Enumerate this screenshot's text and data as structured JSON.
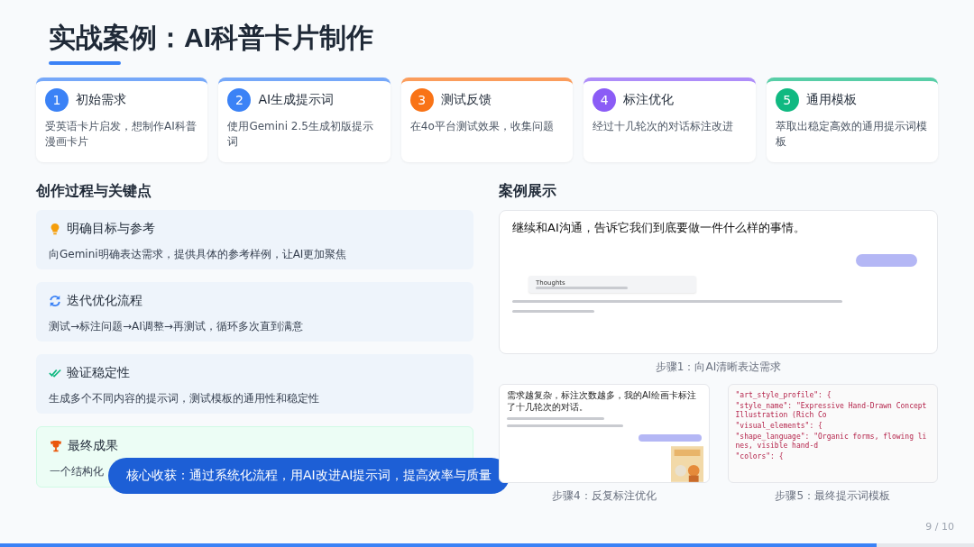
{
  "title": "实战案例：AI科普卡片制作",
  "steps": [
    {
      "number": "1",
      "title": "初始需求",
      "desc": "受英语卡片启发，想制作AI科普漫画卡片",
      "color": "#3b82f6"
    },
    {
      "number": "2",
      "title": "AI生成提示词",
      "desc": "使用Gemini 2.5生成初版提示词",
      "color": "#3b82f6"
    },
    {
      "number": "3",
      "title": "测试反馈",
      "desc": "在4o平台测试效果，收集问题",
      "color": "#f97316"
    },
    {
      "number": "4",
      "title": "标注优化",
      "desc": "经过十几轮次的对话标注改进",
      "color": "#8b5cf6"
    },
    {
      "number": "5",
      "title": "通用模板",
      "desc": "萃取出稳定高效的通用提示词模板",
      "color": "#10b981"
    }
  ],
  "process": {
    "heading": "创作过程与关键点",
    "items": [
      {
        "kind": "bulb",
        "title": "明确目标与参考",
        "desc": "向Gemini明确表达需求，提供具体的参考样例，让AI更加聚焦",
        "highlighted": false
      },
      {
        "kind": "sync",
        "title": "迭代优化流程",
        "desc": "测试→标注问题→AI调整→再测试，循环多次直到满意",
        "highlighted": false
      },
      {
        "kind": "check",
        "title": "验证稳定性",
        "desc": "生成多个不同内容的提示词，测试模板的通用性和稳定性",
        "highlighted": false
      },
      {
        "kind": "trophy",
        "title": "最终成果",
        "desc": "一个结构化",
        "highlighted": true
      }
    ]
  },
  "callout": "核心收获：通过系统化流程，用AI改进AI提示词，提高效率与质量",
  "cases": {
    "heading": "案例展示",
    "shot1": {
      "headline": "继续和AI沟通，告诉它我们到底要做一件什么样的事情。",
      "thoughts_title": "Thoughts",
      "caption": "步骤1：向AI清晰表达需求"
    },
    "shot4": {
      "headline": "需求越复杂，标注次数越多，我的AI绘画卡标注了十几轮次的对话。",
      "caption": "步骤4：反复标注优化"
    },
    "shot5": {
      "code": [
        "\"art_style_profile\": {",
        "  \"style_name\": \"Expressive Hand-Drawn Concept Illustration (Rich Co",
        "  \"visual_elements\": {",
        "    \"shape_language\": \"Organic forms, flowing lines, visible hand-d",
        "   \"colors\": {"
      ],
      "caption": "步骤5：最终提示词模板"
    }
  },
  "page": "9 / 10",
  "progress": {
    "level": 0.9
  }
}
